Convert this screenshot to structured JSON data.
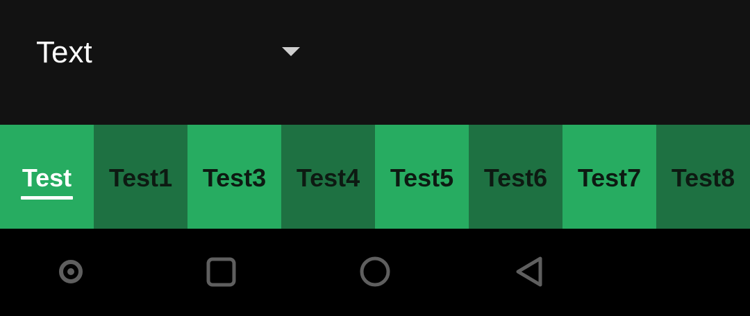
{
  "toolbar": {
    "spinner_value": "Text",
    "dropdown_icon": "caret-down-icon"
  },
  "tabs": [
    {
      "label": "Test",
      "selected": true
    },
    {
      "label": "Test1",
      "selected": false
    },
    {
      "label": "Test3",
      "selected": false
    },
    {
      "label": "Test4",
      "selected": false
    },
    {
      "label": "Test5",
      "selected": false
    },
    {
      "label": "Test6",
      "selected": false
    },
    {
      "label": "Test7",
      "selected": false
    },
    {
      "label": "Test8",
      "selected": false
    }
  ],
  "navbar": {
    "icons": [
      "dot-icon",
      "recents-square-icon",
      "home-circle-icon",
      "back-triangle-icon"
    ]
  },
  "colors": {
    "toolbar_bg": "#121212",
    "tab_light": "#27ac61",
    "tab_dark": "#1e7142",
    "nav_icon": "#5f5f5f"
  }
}
